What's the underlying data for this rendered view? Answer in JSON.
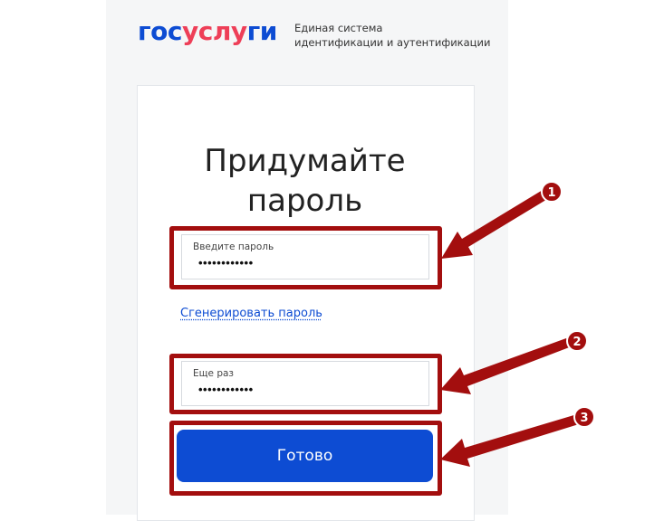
{
  "logo": {
    "word_part1": "гос",
    "word_part2": "услу",
    "word_part3": "ги",
    "subtitle_line1": "Единая система",
    "subtitle_line2": "идентификации и аутентификации"
  },
  "form": {
    "title_line1": "Придумайте",
    "title_line2": "пароль",
    "password_label": "Введите пароль",
    "password_value": "••••••••••••",
    "generate_link": "Сгенерировать пароль",
    "repeat_label": "Еще раз",
    "repeat_value": "••••••••••••",
    "submit_label": "Готово"
  },
  "annotations": {
    "steps": [
      "1",
      "2",
      "3"
    ]
  },
  "colors": {
    "brand_blue": "#0d4cd3",
    "brand_red": "#ee3f58",
    "annotation_red": "#a30e0e"
  }
}
